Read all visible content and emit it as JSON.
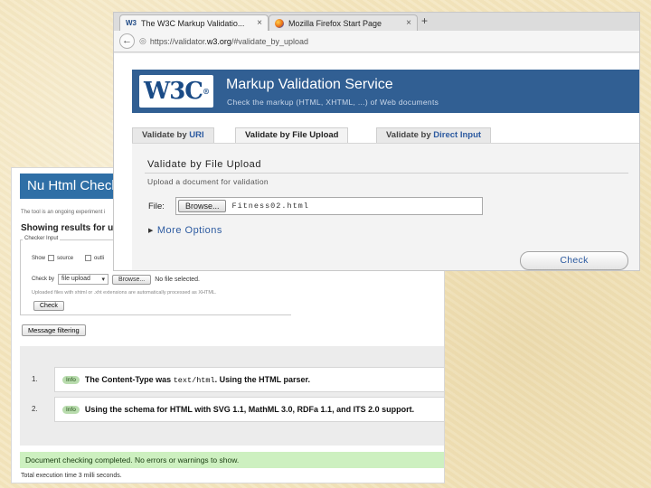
{
  "nu_checker": {
    "banner_title": "Nu Html Check",
    "intro_text": "The tool is an ongoing experiment i",
    "results_heading": "Showing results for up",
    "checker_input_legend": "Checker Input",
    "show_label": "Show",
    "source_label": "source",
    "outline_label": "outli",
    "check_by_label": "Check by",
    "check_by_value": "file upload",
    "browse_label": "Browse...",
    "no_file_text": "No file selected.",
    "note_text": "Uploaded files with xhtml or .xht extensions are automatically processed as XHTML.",
    "check_label": "Check",
    "message_filtering_label": "Message filtering",
    "messages": [
      {
        "number": "1.",
        "badge": "Info",
        "text_before": "The Content-Type was ",
        "code": "text/html",
        "text_after": ". Using the HTML parser."
      },
      {
        "number": "2.",
        "badge": "Info",
        "text_before": "Using the schema for HTML with SVG 1.1, MathML 3.0, RDFa 1.1, and ITS 2.0 support.",
        "code": "",
        "text_after": ""
      }
    ],
    "completed_text": "Document checking completed. No errors or warnings to show.",
    "execution_text": "Total execution time 3 milli seconds."
  },
  "firefox": {
    "tabs": [
      {
        "icon": "W3",
        "label": "The W3C Markup Validatio...",
        "close": "×"
      },
      {
        "icon": "firefox-icon",
        "label": "Mozilla Firefox Start Page",
        "close": "×"
      }
    ],
    "new_tab": "+",
    "url_prefix": "https://validator.",
    "url_domain": "w3.org",
    "url_suffix": "/#validate_by_upload"
  },
  "validator": {
    "logo_text": "W3C",
    "logo_mark": "®",
    "title": "Markup Validation Service",
    "subtitle": "Check the markup (HTML, XHTML, ...) of Web documents",
    "tabs": [
      {
        "prefix": "Validate by ",
        "highlight": "URI"
      },
      {
        "prefix": "Validate by ",
        "highlight": "File Upload"
      },
      {
        "prefix": "Validate by ",
        "highlight": "Direct Input"
      }
    ],
    "panel_title": "Validate by File Upload",
    "panel_subtitle": "Upload a document for validation",
    "file_label": "File:",
    "browse_label": "Browse...",
    "file_name": "Fitness02.html",
    "more_options": "More Options",
    "check_label": "Check"
  },
  "colors": {
    "w3c_header": "#315f93",
    "link_blue": "#2c5aa0",
    "nu_banner": "#2f6fa6",
    "success_green": "#cdf0c0",
    "background_parchment": "#f4e6bf"
  }
}
